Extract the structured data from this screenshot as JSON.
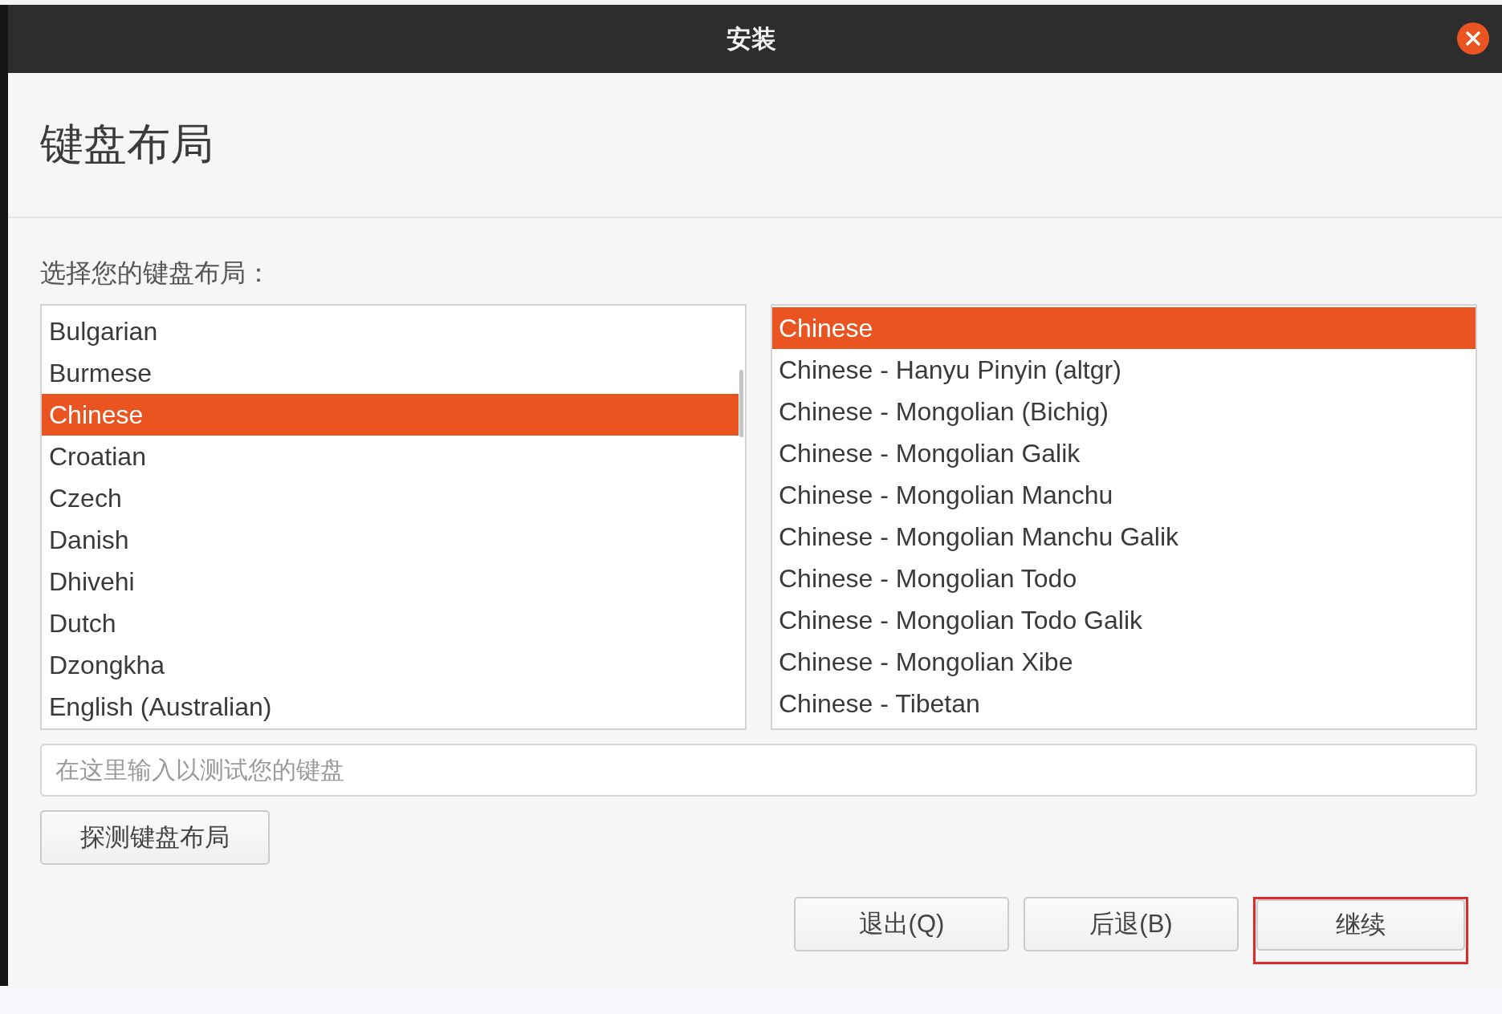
{
  "window": {
    "title": "安装"
  },
  "page_title": "键盘布局",
  "prompt": "选择您的键盘布局：",
  "layouts": [
    {
      "label": "Bulgarian",
      "selected": false
    },
    {
      "label": "Burmese",
      "selected": false
    },
    {
      "label": "Chinese",
      "selected": true
    },
    {
      "label": "Croatian",
      "selected": false
    },
    {
      "label": "Czech",
      "selected": false
    },
    {
      "label": "Danish",
      "selected": false
    },
    {
      "label": "Dhivehi",
      "selected": false
    },
    {
      "label": "Dutch",
      "selected": false
    },
    {
      "label": "Dzongkha",
      "selected": false
    },
    {
      "label": "English (Australian)",
      "selected": false
    }
  ],
  "variants": [
    {
      "label": "Chinese",
      "selected": true
    },
    {
      "label": "Chinese - Hanyu Pinyin (altgr)",
      "selected": false
    },
    {
      "label": "Chinese - Mongolian (Bichig)",
      "selected": false
    },
    {
      "label": "Chinese - Mongolian Galik",
      "selected": false
    },
    {
      "label": "Chinese - Mongolian Manchu",
      "selected": false
    },
    {
      "label": "Chinese - Mongolian Manchu Galik",
      "selected": false
    },
    {
      "label": "Chinese - Mongolian Todo",
      "selected": false
    },
    {
      "label": "Chinese - Mongolian Todo Galik",
      "selected": false
    },
    {
      "label": "Chinese - Mongolian Xibe",
      "selected": false
    },
    {
      "label": "Chinese - Tibetan",
      "selected": false
    }
  ],
  "test_field": {
    "placeholder": "在这里输入以测试您的键盘"
  },
  "detect_button": "探测键盘布局",
  "buttons": [
    {
      "label": "退出(Q)",
      "highlighted": false
    },
    {
      "label": "后退(B)",
      "highlighted": false
    },
    {
      "label": "继续",
      "highlighted": true
    }
  ]
}
